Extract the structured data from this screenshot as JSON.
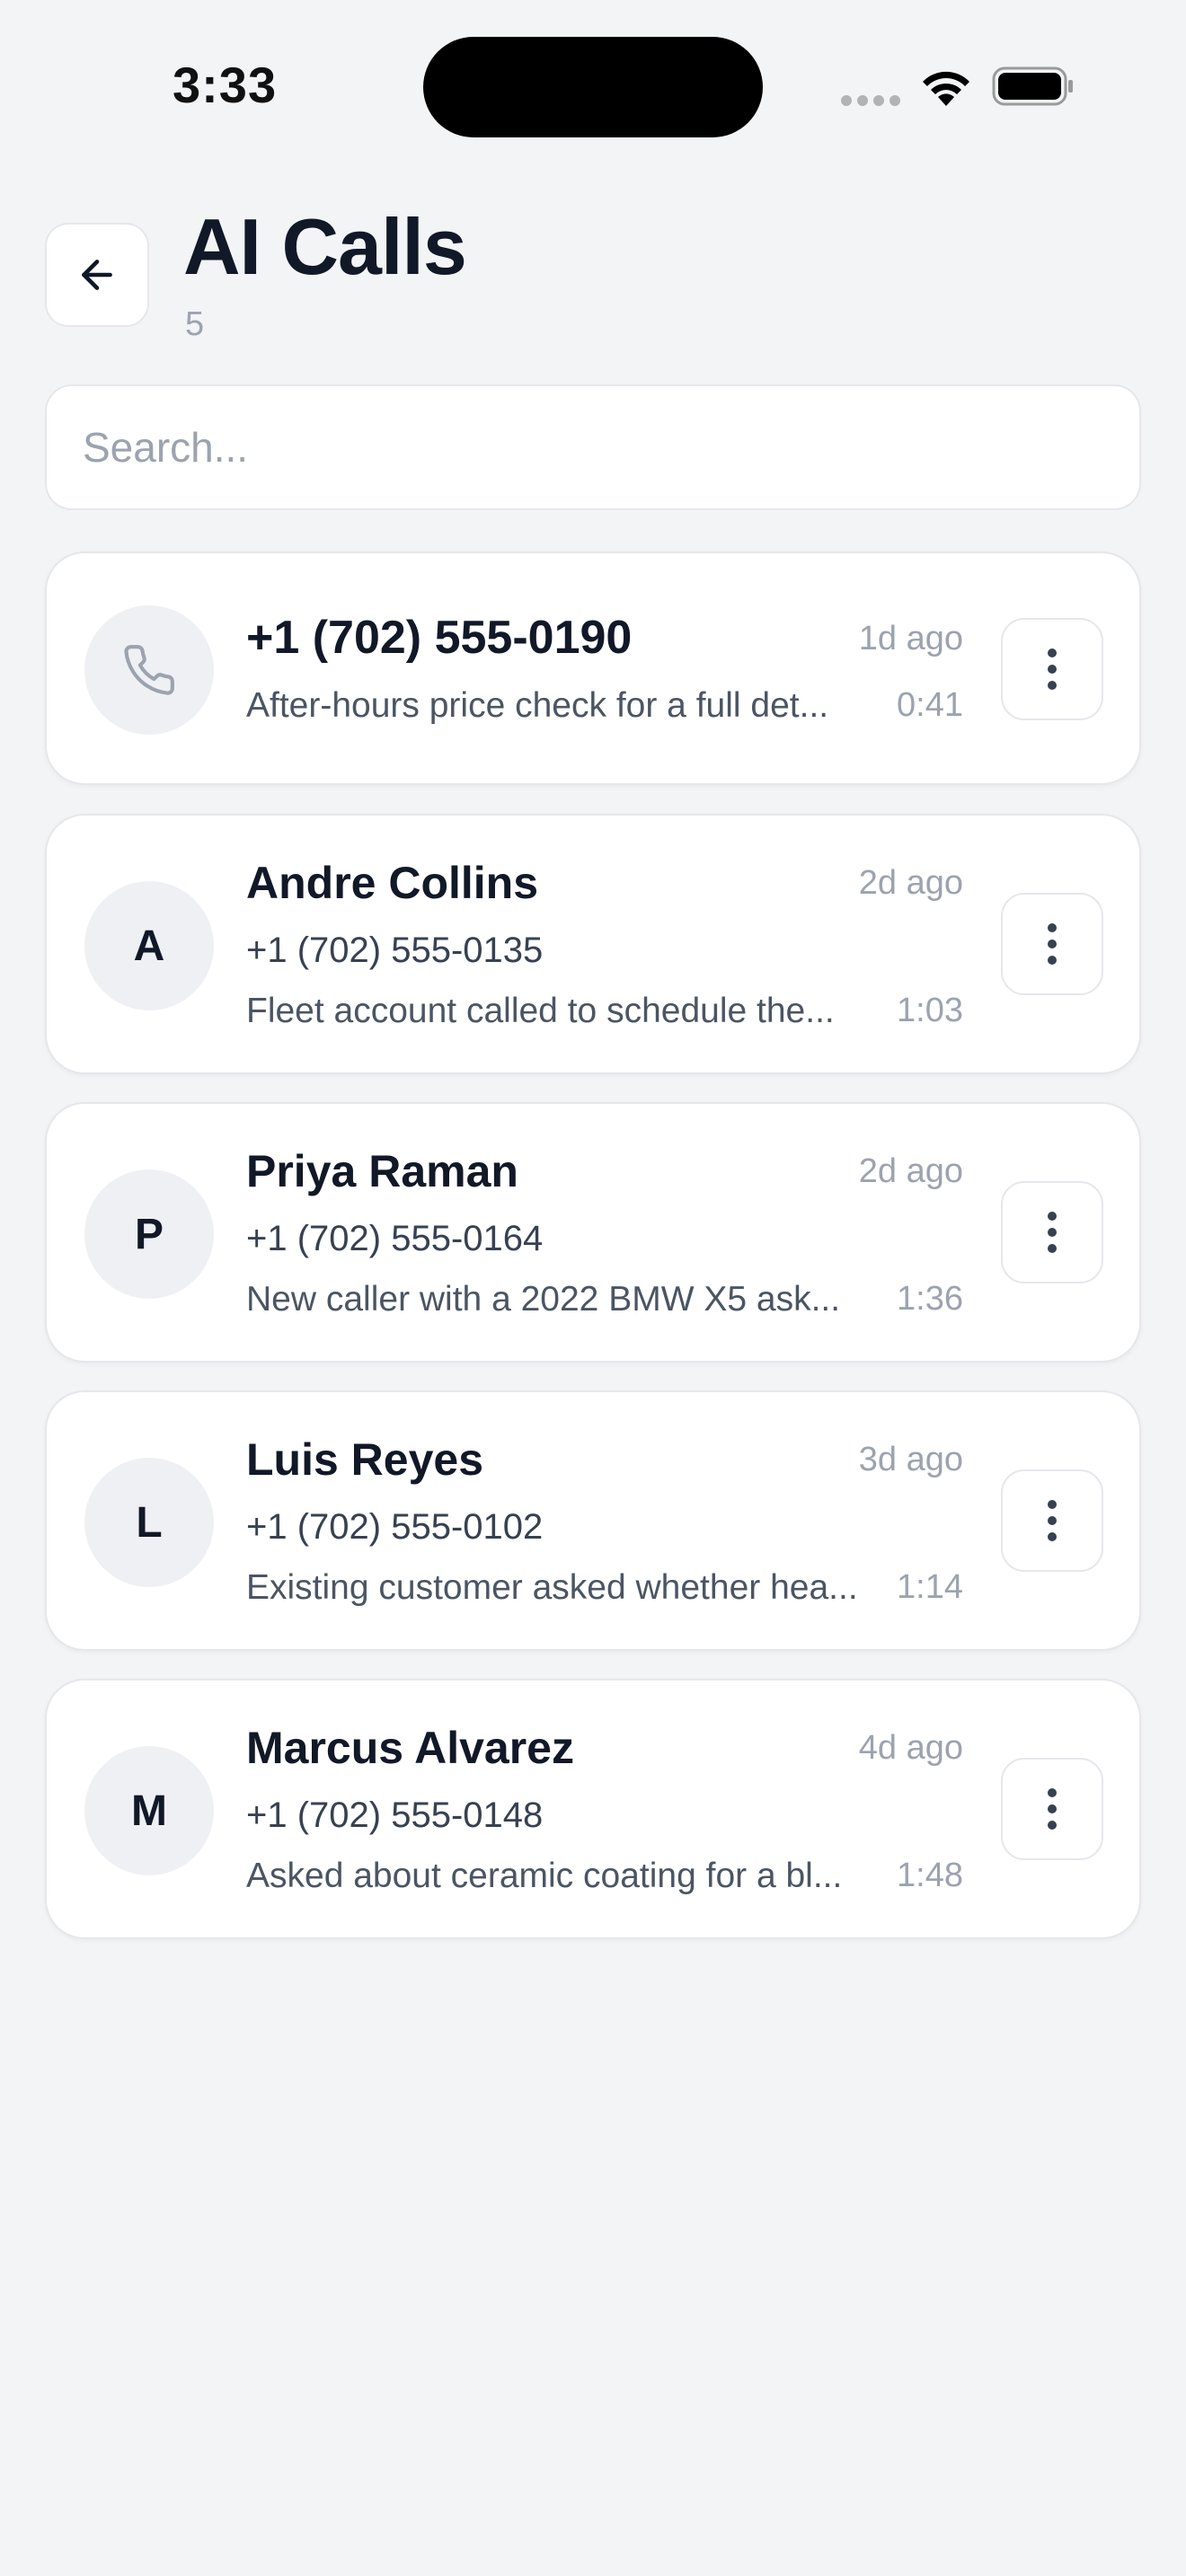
{
  "status_bar": {
    "time": "3:33"
  },
  "header": {
    "back_icon": "arrow-left-icon",
    "title": "AI Calls",
    "count": "5"
  },
  "search": {
    "placeholder": "Search...",
    "value": ""
  },
  "calls": [
    {
      "avatar": "",
      "avatar_icon": "phone-icon",
      "name": "+1 (702) 555-0190",
      "phone": "",
      "time_ago": "1d ago",
      "summary": "After-hours price check for a full det...",
      "duration": "0:41"
    },
    {
      "avatar": "A",
      "name": "Andre Collins",
      "phone": "+1 (702) 555-0135",
      "time_ago": "2d ago",
      "summary": "Fleet account called to schedule the...",
      "duration": "1:03"
    },
    {
      "avatar": "P",
      "name": "Priya Raman",
      "phone": "+1 (702) 555-0164",
      "time_ago": "2d ago",
      "summary": "New caller with a 2022 BMW X5 ask...",
      "duration": "1:36"
    },
    {
      "avatar": "L",
      "name": "Luis Reyes",
      "phone": "+1 (702) 555-0102",
      "time_ago": "3d ago",
      "summary": "Existing customer asked whether hea...",
      "duration": "1:14"
    },
    {
      "avatar": "M",
      "name": "Marcus Alvarez",
      "phone": "+1 (702) 555-0148",
      "time_ago": "4d ago",
      "summary": "Asked about ceramic coating for a bl...",
      "duration": "1:48"
    }
  ],
  "more_icon": "more-vertical-icon"
}
